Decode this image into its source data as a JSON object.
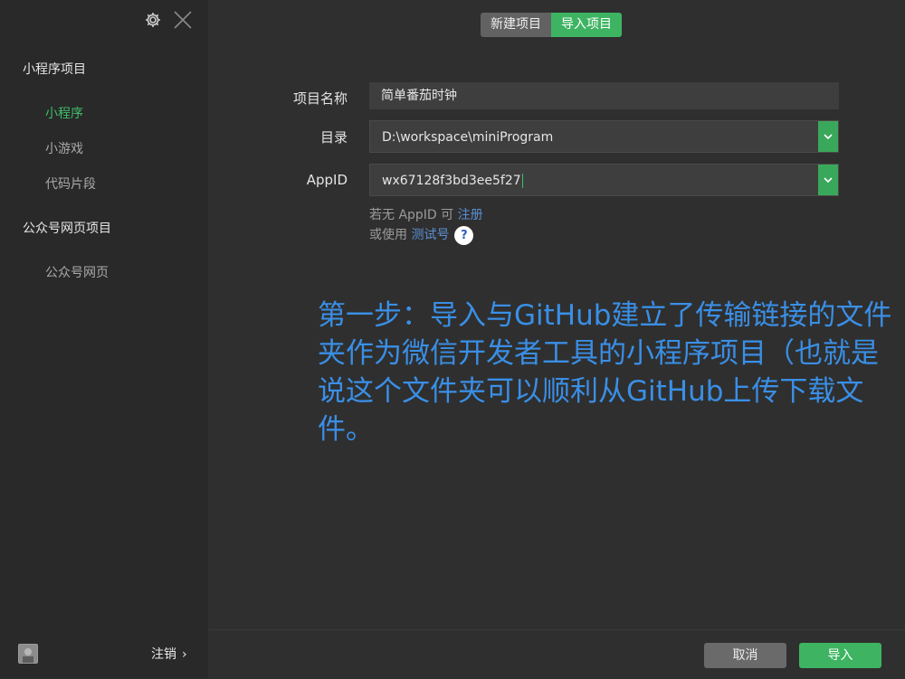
{
  "sidebar": {
    "section1_title": "小程序项目",
    "section1_items": [
      "小程序",
      "小游戏",
      "代码片段"
    ],
    "section2_title": "公众号网页项目",
    "section2_items": [
      "公众号网页"
    ],
    "logout_label": "注销",
    "icons": {
      "settings": "gear-icon",
      "close": "close-icon",
      "avatar": "avatar",
      "arrow": "chevron-right-icon"
    }
  },
  "tabs": {
    "new_label": "新建项目",
    "import_label": "导入项目",
    "active": "导入项目"
  },
  "form": {
    "name_label": "项目名称",
    "name_value": "简单番茄时钟",
    "dir_label": "目录",
    "dir_value": "D:\\workspace\\miniProgram",
    "appid_label": "AppID",
    "appid_value": "wx67128f3bd3ee5f27",
    "hint1_prefix": "若无 AppID 可 ",
    "hint1_link": "注册",
    "hint2_prefix": "或使用 ",
    "hint2_link": "测试号",
    "help_symbol": "?"
  },
  "annotation": "第一步：导入与GitHub建立了传输链接的文件夹作为微信开发者工具的小程序项目（也就是说这个文件夹可以顺利从GitHub上传下载文件。",
  "footer": {
    "cancel_label": "取消",
    "import_label": "导入"
  },
  "colors": {
    "accent_green": "#3eb462",
    "link_blue": "#5b8fd4",
    "annotation_blue": "#3a8fe6"
  }
}
